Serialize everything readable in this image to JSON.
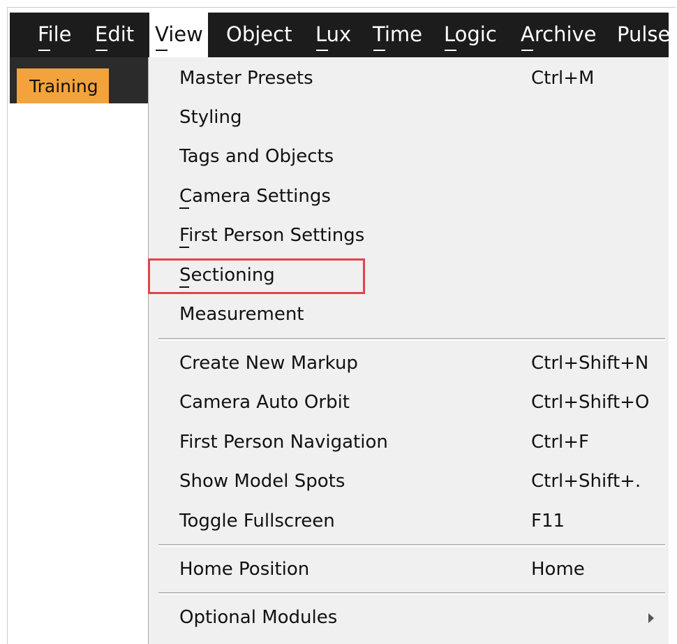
{
  "menubar": {
    "items": [
      {
        "label": "File"
      },
      {
        "label": "Edit"
      },
      {
        "label": "View"
      },
      {
        "label": "Object"
      },
      {
        "label": "Lux"
      },
      {
        "label": "Time"
      },
      {
        "label": "Logic"
      },
      {
        "label": "Archive"
      },
      {
        "label": "Pulse"
      }
    ],
    "active": "View"
  },
  "workspace_tab": {
    "label": "Training"
  },
  "view_menu": {
    "items": [
      {
        "label": "Master Presets",
        "shortcut": "Ctrl+M"
      },
      {
        "label": "Styling",
        "shortcut": ""
      },
      {
        "label": "Tags and Objects",
        "shortcut": ""
      },
      {
        "label": "Camera Settings",
        "shortcut": ""
      },
      {
        "label": "First Person Settings",
        "shortcut": ""
      },
      {
        "label": "Sectioning",
        "shortcut": ""
      },
      {
        "label": "Measurement",
        "shortcut": ""
      },
      {
        "label": "Create New Markup",
        "shortcut": "Ctrl+Shift+N"
      },
      {
        "label": "Camera Auto Orbit",
        "shortcut": "Ctrl+Shift+O"
      },
      {
        "label": "First Person Navigation",
        "shortcut": "Ctrl+F"
      },
      {
        "label": "Show Model Spots",
        "shortcut": "Ctrl+Shift+."
      },
      {
        "label": "Toggle Fullscreen",
        "shortcut": "F11"
      },
      {
        "label": "Home Position",
        "shortcut": "Home"
      },
      {
        "label": "Optional Modules",
        "shortcut": ""
      }
    ],
    "highlighted_item": "Sectioning"
  },
  "colors": {
    "menubar_bg": "#1c1c1c",
    "menu_bg": "#f0f0f0",
    "tab_orange": "#f3a33b",
    "highlight_red": "#e3424a"
  }
}
